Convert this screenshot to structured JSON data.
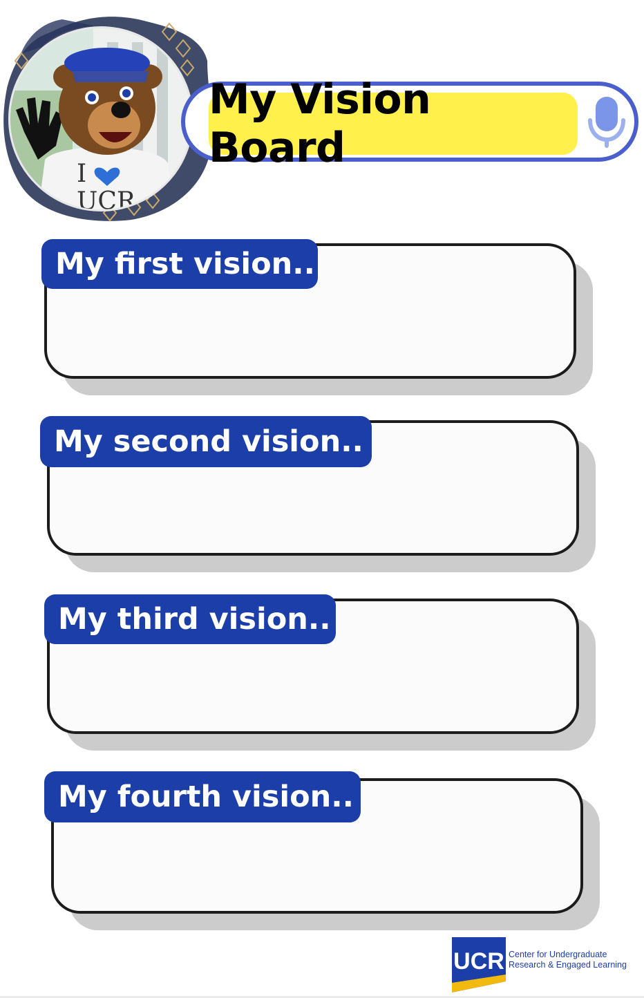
{
  "header": {
    "title": "My Vision Board",
    "icon": "microphone-icon"
  },
  "avatar": {
    "shirt_text_top": "I",
    "shirt_text_bottom": "UCR"
  },
  "visions": [
    {
      "label": "My first vision..",
      "content": ""
    },
    {
      "label": "My second vision..",
      "content": ""
    },
    {
      "label": "My third vision..",
      "content": ""
    },
    {
      "label": "My fourth vision..",
      "content": ""
    }
  ],
  "footer": {
    "logo_mark": "UCR",
    "org_line1": "Center for Undergraduate",
    "org_line2": "Research & Engaged Learning"
  },
  "colors": {
    "tag_blue": "#1c3ea8",
    "title_yellow": "#fff04c",
    "pill_border": "#4a5fcc",
    "logo_gold": "#f2b90f"
  }
}
